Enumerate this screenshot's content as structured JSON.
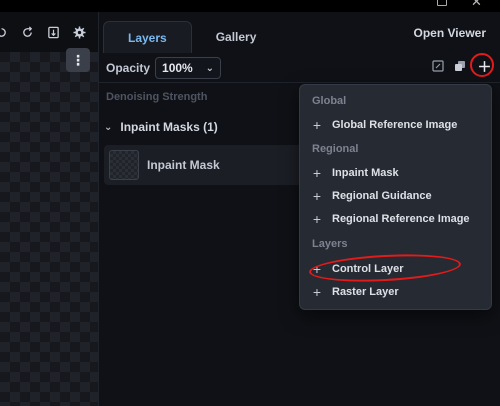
{
  "canvas": {
    "toolbar_icons": [
      "undo-icon",
      "redo-icon",
      "save-icon",
      "settings-icon"
    ],
    "menu_icon": "more-vertical-icon"
  },
  "tabs": {
    "layers": "Layers",
    "gallery": "Gallery",
    "open_viewer": "Open Viewer"
  },
  "toolbar": {
    "opacity_label": "Opacity",
    "opacity_value": "100%",
    "icons": [
      "fit-icon",
      "merge-icon",
      "add-layer-icon"
    ]
  },
  "denoising": {
    "label": "Denoising Strength"
  },
  "inpaint_masks": {
    "header": "Inpaint Masks (1)",
    "items": [
      {
        "name": "Inpaint Mask"
      }
    ]
  },
  "add_menu": {
    "groups": [
      {
        "label": "Global",
        "items": [
          "Global Reference Image"
        ]
      },
      {
        "label": "Regional",
        "items": [
          "Inpaint Mask",
          "Regional Guidance",
          "Regional Reference Image"
        ]
      },
      {
        "label": "Layers",
        "items": [
          "Control Layer",
          "Raster Layer"
        ]
      }
    ]
  },
  "annotation_color": "#e21b1b",
  "accent_color": "#7bb8ee"
}
